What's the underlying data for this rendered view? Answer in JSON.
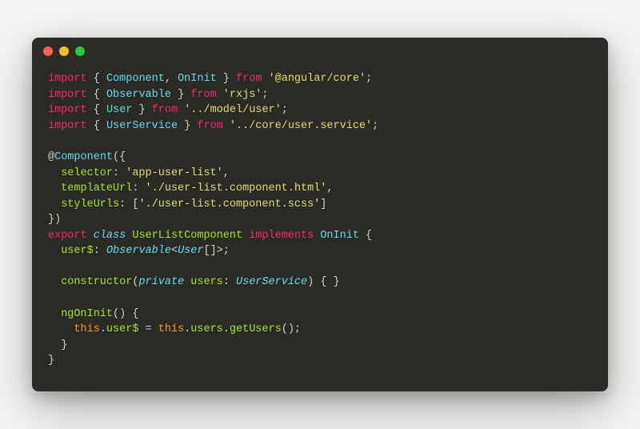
{
  "titlebar": {
    "buttons": [
      "close",
      "minimize",
      "zoom"
    ]
  },
  "code": {
    "l1": {
      "kw": "import",
      "n1": "Component",
      "n2": "OnInit",
      "from": "from",
      "str": "'@angular/core'"
    },
    "l2": {
      "kw": "import",
      "n1": "Observable",
      "from": "from",
      "str": "'rxjs'"
    },
    "l3": {
      "kw": "import",
      "n1": "User",
      "from": "from",
      "str": "'../model/user'"
    },
    "l4": {
      "kw": "import",
      "n1": "UserService",
      "from": "from",
      "str": "'../core/user.service'"
    },
    "l6": {
      "dec": "Component"
    },
    "l7": {
      "prop": "selector",
      "val": "'app-user-list'"
    },
    "l8": {
      "prop": "templateUrl",
      "val": "'./user-list.component.html'"
    },
    "l9": {
      "prop": "styleUrls",
      "val": "'./user-list.component.scss'"
    },
    "l11": {
      "exp": "export",
      "cls": "class",
      "name": "UserListComponent",
      "impl": "implements",
      "iface": "OnInit"
    },
    "l12": {
      "field": "user$",
      "type1": "Observable",
      "type2": "User"
    },
    "l14": {
      "ctor": "constructor",
      "priv": "private",
      "param": "users",
      "ptype": "UserService"
    },
    "l16": {
      "fn": "ngOnInit"
    },
    "l17": {
      "this1": "this",
      "f1": "user$",
      "this2": "this",
      "f2": "users",
      "m": "getUsers"
    }
  }
}
